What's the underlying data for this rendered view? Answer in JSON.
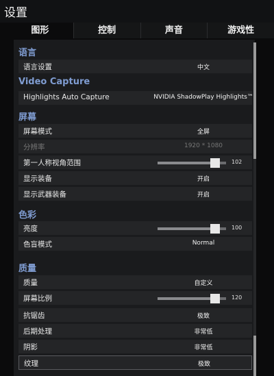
{
  "window": {
    "title": "设置"
  },
  "tabs": [
    {
      "label": "图形"
    },
    {
      "label": "控制"
    },
    {
      "label": "声音"
    },
    {
      "label": "游戏性"
    }
  ],
  "sections": {
    "language": "语言",
    "video_capture": "Video Capture",
    "screen": "屏幕",
    "color": "色彩",
    "quality": "质量"
  },
  "rows": {
    "language_setting": {
      "label": "语言设置",
      "value": "中文"
    },
    "highlights": {
      "label": "Highlights Auto Capture",
      "value": "NVIDIA ShadowPlay Highlights™"
    },
    "screen_mode": {
      "label": "屏幕模式",
      "value": "全屏"
    },
    "resolution": {
      "label": "分辨率",
      "value": "1920 * 1080"
    },
    "fov": {
      "label": "第一人称视角范围",
      "value": "102",
      "level": 0.9
    },
    "show_gear": {
      "label": "显示装备",
      "value": "开启"
    },
    "show_weapon": {
      "label": "显示武器装备",
      "value": "开启"
    },
    "brightness": {
      "label": "亮度",
      "value": "100",
      "level": 0.9
    },
    "colorblind": {
      "label": "色盲模式",
      "value": "Normal"
    },
    "quality": {
      "label": "质量",
      "value": "自定义"
    },
    "screen_scale": {
      "label": "屏幕比例",
      "value": "120",
      "level": 0.9
    },
    "antialias": {
      "label": "抗锯齿",
      "value": "极致"
    },
    "post_processing": {
      "label": "后期处理",
      "value": "非常低"
    },
    "shadows": {
      "label": "阴影",
      "value": "非常低"
    },
    "textures": {
      "label": "纹理",
      "value": "极致"
    }
  }
}
